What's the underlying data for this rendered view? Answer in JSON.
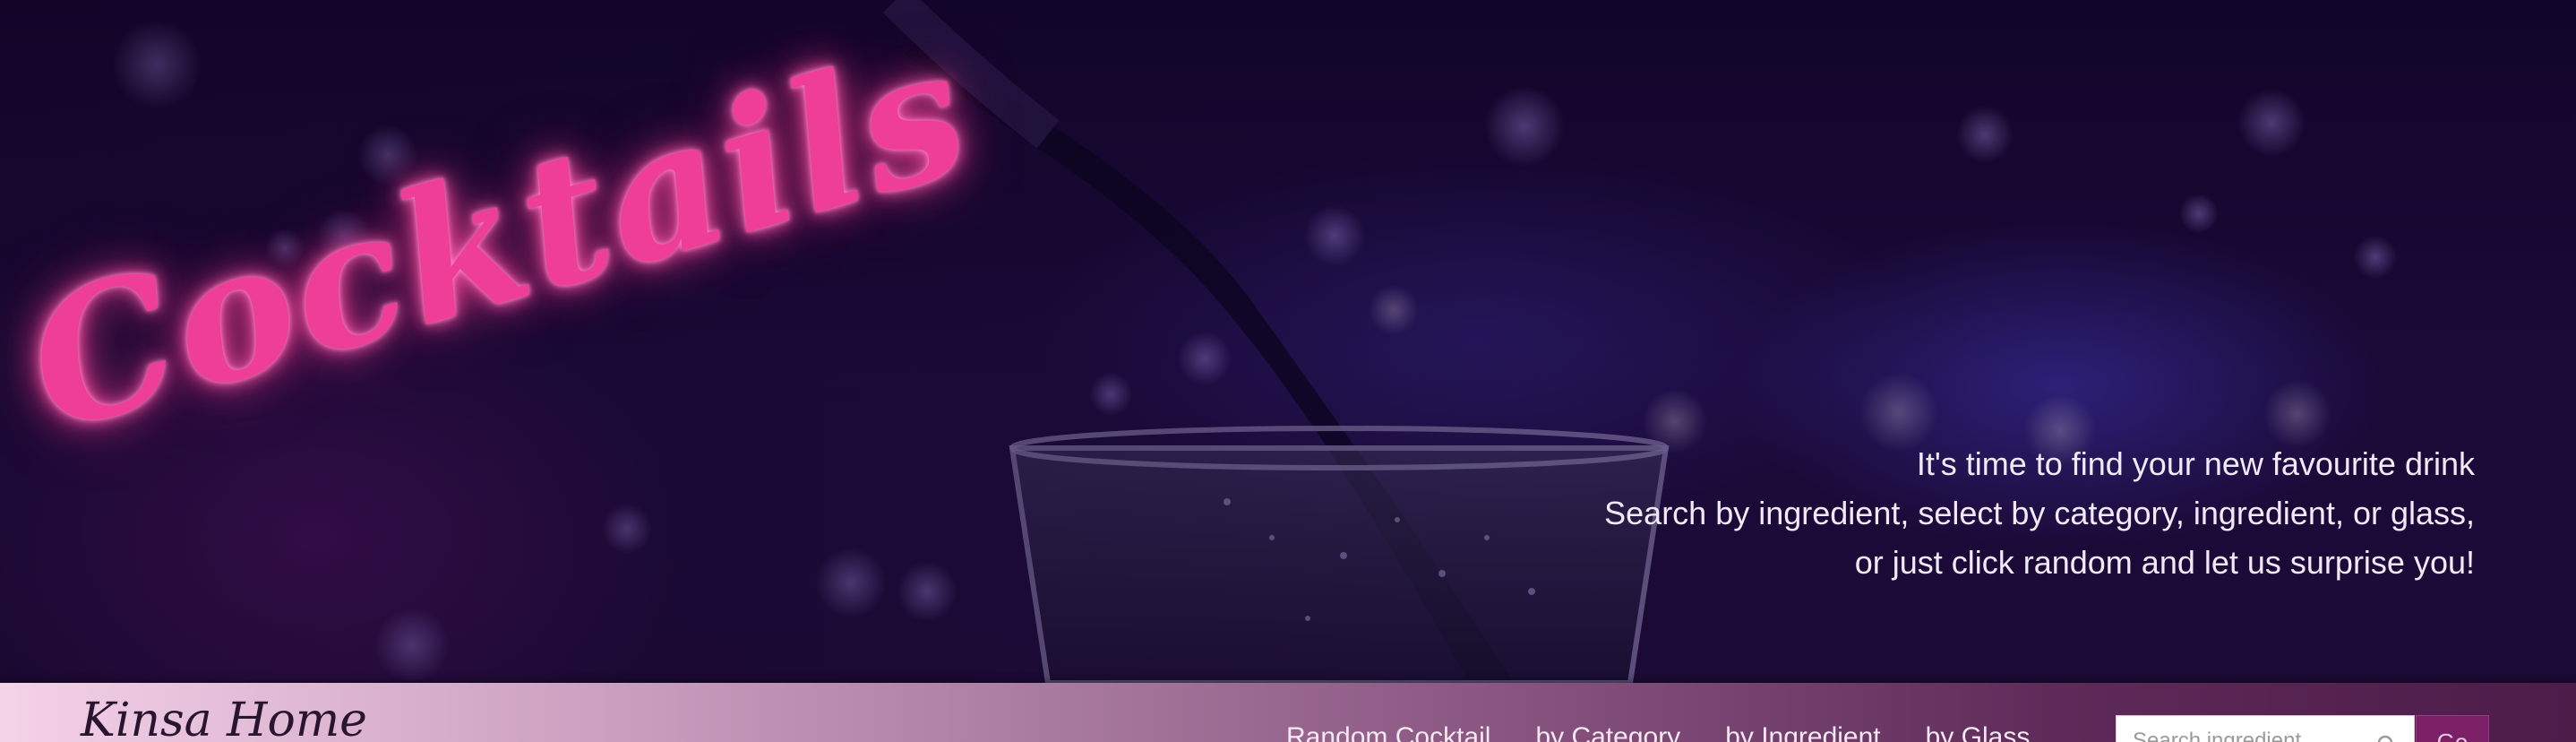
{
  "hero": {
    "logo_text": "Cocktails",
    "tagline_lines": [
      "It's time to find your new favourite drink",
      "Search by ingredient, select by category, ingredient, or glass,",
      "or just click random and let us surprise you!"
    ]
  },
  "navbar": {
    "home_label": "Kinsa Home",
    "links": [
      "Random Cocktail",
      "by Category",
      "by Ingredient",
      "by Glass"
    ],
    "search": {
      "placeholder": "Search ingredient",
      "button_label": "Go"
    }
  },
  "colors": {
    "neon_pink": "#ef3e97",
    "accent_button": "#7b1f66",
    "hero_background": "#14062a"
  },
  "icons": [
    "search-icon"
  ]
}
